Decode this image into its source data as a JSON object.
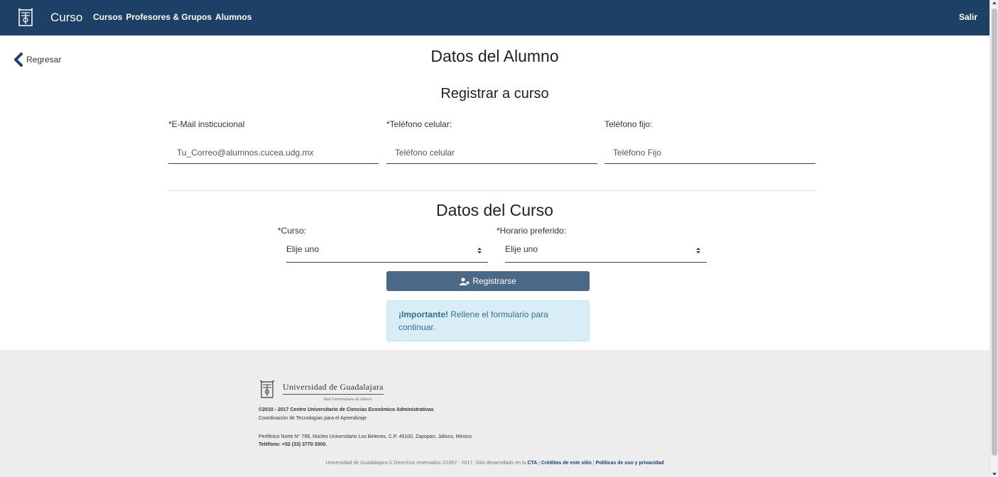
{
  "navbar": {
    "brand": "Curso",
    "links": [
      "Cursos",
      "Profesores & Grupos",
      "Alumnos"
    ],
    "logout": "Salir"
  },
  "back": {
    "label": "Regresar"
  },
  "titles": {
    "main": "Datos del Alumno",
    "section1": "Registrar a curso",
    "section2": "Datos del Curso"
  },
  "form": {
    "email_label": "*E-Mail insticucional",
    "email_placeholder": "Tu_Correo@alumnos.cucea.udg.mx",
    "cell_label": "*Teléfono celular:",
    "cell_placeholder": "Teléfono celular",
    "phone_label": "Teléfono fijo:",
    "phone_placeholder": "Teléfono Fijo",
    "course_label": "*Curso:",
    "course_value": "Elije uno",
    "schedule_label": "*Horario preferido:",
    "schedule_value": "Elije uno",
    "submit_label": "Registrarse"
  },
  "alert": {
    "strong": "¡Importante!",
    "text": " Rellene el formulario para continuar."
  },
  "footer": {
    "university": "Universidad de Guadalajara",
    "network": "Red Universitaria de Jalisco",
    "copyright": "©2010 - 2017 Centro Universitario de Ciencias Económico Administrativas",
    "coordination": "Coordinación de Tecnologías para el Aprendizaje",
    "address": "Periférico Norte N° 799, Núcleo Universitario Los Belenes, C.P. 45100, Zapopan, Jalisco, México.",
    "phone": "Teléfono: +52 (33) 3770 3300.",
    "bottom_text": "Universidad de Guadalajara © Derechos reservados ©1997 - 2017. Sitio desarrollado en la ",
    "cta_link": "CTA",
    "separator": " | ",
    "credits_link": "Créditos de este sitio",
    "policy_link": "Políticas de uso y privacidad"
  },
  "colors": {
    "navbar": "#1e3f66",
    "button": "#4b6887",
    "alert_bg": "#d9edf7",
    "alert_text": "#31708f",
    "footer_bg": "#ededed"
  }
}
